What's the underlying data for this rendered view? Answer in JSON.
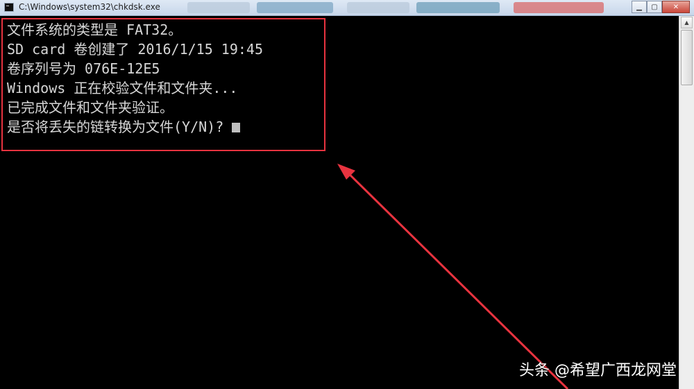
{
  "window": {
    "title": "C:\\Windows\\system32\\chkdsk.exe",
    "minimize_label": "▁",
    "maximize_label": "▢",
    "close_label": "✕"
  },
  "console": {
    "lines": [
      "文件系统的类型是 FAT32。",
      "SD card 卷创建了 2016/1/15 19:45",
      "卷序列号为 076E-12E5",
      "Windows 正在校验文件和文件夹...",
      "已完成文件和文件夹验证。",
      "是否将丢失的链转换为文件(Y/N)?"
    ]
  },
  "annotation": {
    "highlight_color": "#e8333f"
  },
  "watermark": {
    "text": "头条 @希望广西龙网堂"
  }
}
